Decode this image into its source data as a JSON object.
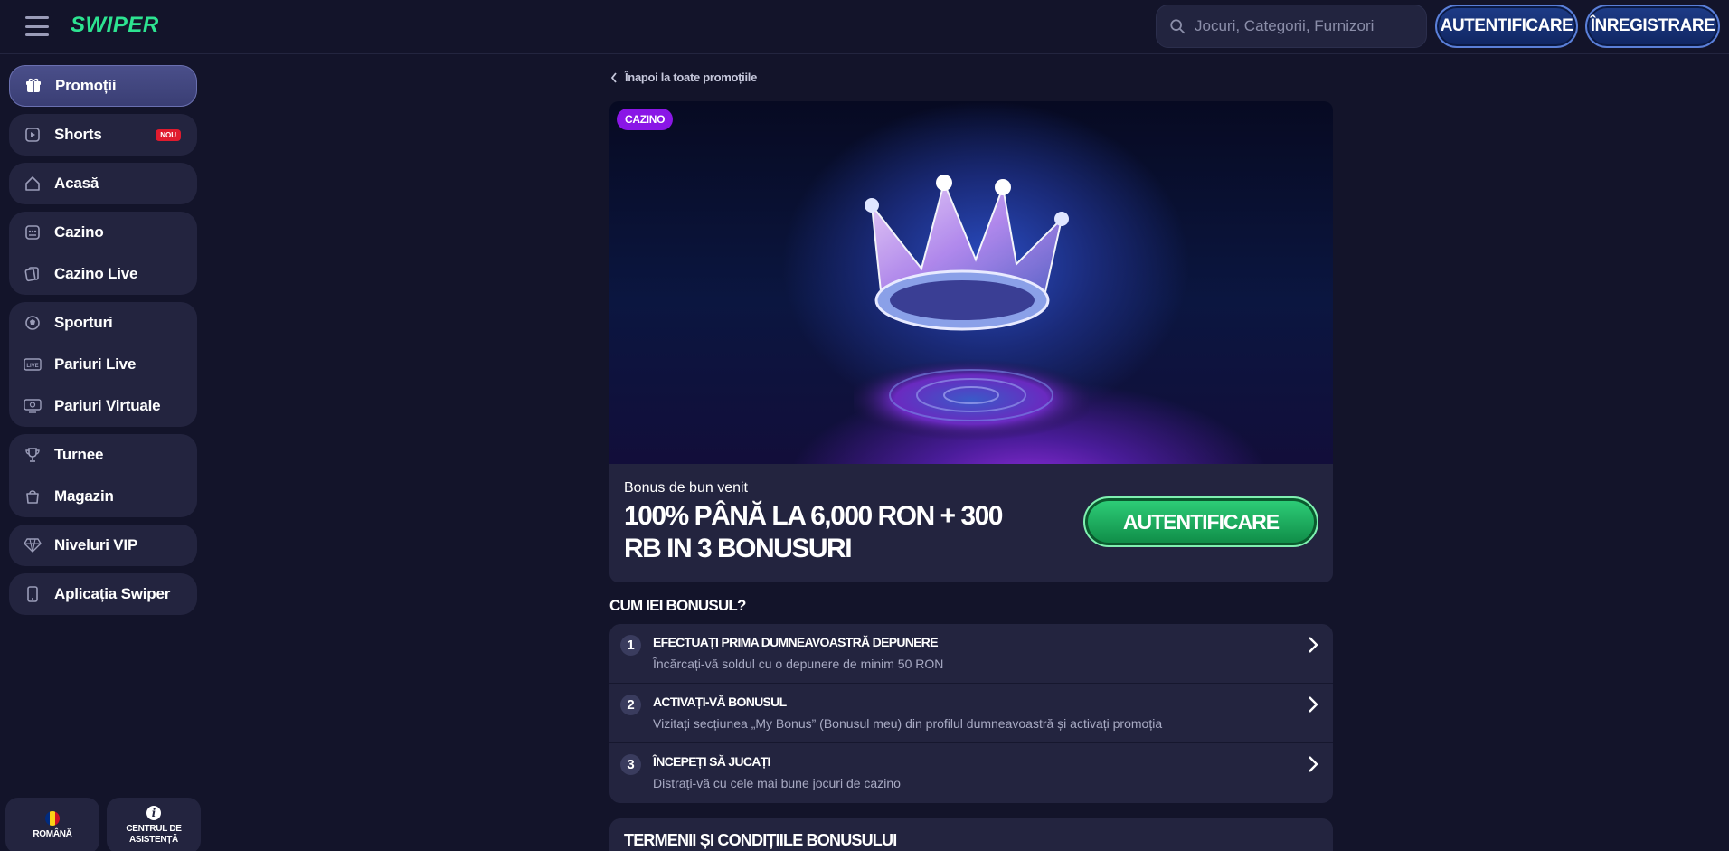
{
  "header": {
    "logo": "SWIPER",
    "search_placeholder": "Jocuri, Categorii, Furnizori",
    "login_label": "AUTENTIFICARE",
    "register_label": "ÎNREGISTRARE"
  },
  "sidebar": {
    "promotions": "Promoții",
    "shorts": "Shorts",
    "shorts_badge": "NOU",
    "home": "Acasă",
    "casino": "Cazino",
    "live_casino": "Cazino Live",
    "sports": "Sporturi",
    "live_bets": "Pariuri Live",
    "virtual_bets": "Pariuri Virtuale",
    "tournaments": "Turnee",
    "shop": "Magazin",
    "vip_levels": "Niveluri VIP",
    "app": "Aplicația Swiper",
    "footer_language": "ROMÂNĂ",
    "footer_help": "CENTRUL DE ASISTENȚĂ"
  },
  "main": {
    "back_link": "Înapoi la toate promoțiile",
    "hero_badge": "CAZINO",
    "promo_subtitle": "Bonus de bun venit",
    "promo_title": "100% PÂNĂ LA 6,000 RON + 300 RB IN 3 BONUSURI",
    "promo_button": "AUTENTIFICARE",
    "how_title": "CUM IEI BONUSUL?",
    "steps": [
      {
        "num": "1",
        "title": "EFECTUAȚI PRIMA DUMNEAVOASTRĂ DEPUNERE",
        "desc": "Încărcați-vă soldul cu o depunere de minim 50 RON"
      },
      {
        "num": "2",
        "title": "ACTIVAȚI-VĂ BONUSUL",
        "desc": "Vizitați secțiunea „My Bonus” (Bonusul meu) din profilul dumneavoastră și activați promoția"
      },
      {
        "num": "3",
        "title": "ÎNCEPEȚI SĂ JUCAȚI",
        "desc": "Distrați-vă cu cele mai bune jocuri de cazino"
      }
    ],
    "terms_title": "TERMENII ȘI CONDIȚIILE BONUSULUI"
  },
  "colors": {
    "background": "#13142a",
    "card": "#23243f",
    "accent_green": "#2de391",
    "header_button": "#1e3c88",
    "badge_purple": "#8a16e6",
    "badge_red": "#e01b2e"
  }
}
